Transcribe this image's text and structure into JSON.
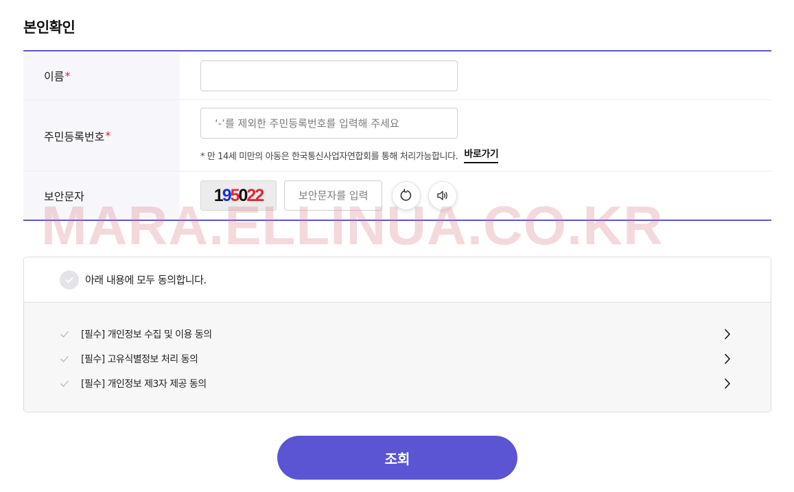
{
  "section": {
    "title": "본인확인"
  },
  "form": {
    "name": {
      "label": "이름",
      "required_mark": "*",
      "value": "",
      "placeholder": ""
    },
    "rrn": {
      "label": "주민등록번호",
      "required_mark": "*",
      "placeholder": "‘-’를 제외한 주민등록번호를 입력해 주세요",
      "hint": "* 만 14세 미만의 아동은 한국통신사업자연합회를 통해 처리가능합니다.",
      "hint_link": "바로가기"
    },
    "captcha": {
      "label": "보안문자",
      "digits": [
        "1",
        "9",
        "5",
        "0",
        "2",
        "2"
      ],
      "placeholder": "보안문자를 입력",
      "refresh_icon": "refresh-icon",
      "audio_icon": "speaker-icon"
    }
  },
  "watermark": "MARA.ELLINUA.CO.KR",
  "agreement": {
    "all_label": "아래 내용에 모두 동의합니다.",
    "items": [
      {
        "label": "[필수] 개인정보 수집 및 이용 동의"
      },
      {
        "label": "[필수] 고유식별정보 처리 동의"
      },
      {
        "label": "[필수] 개인정보 제3자 제공 동의"
      }
    ]
  },
  "submit": {
    "label": "조회"
  },
  "colors": {
    "accent": "#5b55d4",
    "required": "#d8223a",
    "label_bg": "#f7f7fb"
  }
}
